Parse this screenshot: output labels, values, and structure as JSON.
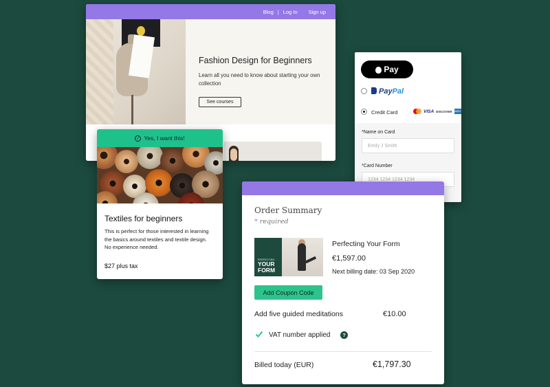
{
  "site": {
    "nav": {
      "blog": "Blog",
      "separator": "|",
      "login": "Log In",
      "signup": "Sign up"
    },
    "hero": {
      "title": "Fashion Design for Beginners",
      "subtitle": "Learn all you need to know about starting your own collection",
      "button": "See courses"
    }
  },
  "textiles": {
    "banner": "Yes, I want this!",
    "title": "Textiles for beginners",
    "description": "This is perfect for those interested in learning the basics around textiles and textile design. No experience needed.",
    "price": "$27 plus tax"
  },
  "payment": {
    "apple_pay": "Pay",
    "paypal_a": "Pay",
    "paypal_b": "Pal",
    "credit_card": "Credit Card",
    "card_logos": {
      "visa": "VISA",
      "discover": "DISCOVER",
      "amex": "AMEX"
    },
    "name_label": "*Name on Card",
    "name_placeholder": "Emily J Smith",
    "number_label": "*Card Number",
    "number_placeholder": "1234 1234 1234 1234",
    "selected": "credit_card"
  },
  "order": {
    "title": "Order Summary",
    "required_star": "*",
    "required": "required",
    "thumb_small": "PERFECTING",
    "thumb_big_1": "YOUR",
    "thumb_big_2": "FORM",
    "product": "Perfecting Your Form",
    "price": "€1,597.00",
    "next_billing": "Next billing date: 03 Sep 2020",
    "coupon_button": "Add Coupon Code",
    "addon": "Add five guided meditations",
    "addon_price": "€10.00",
    "vat": "VAT number applied",
    "help": "?",
    "billed_label": "Billed today (EUR)",
    "billed_total": "€1,797.30"
  },
  "colors": {
    "background": "#1c4a3e",
    "purple": "#9478e6",
    "green": "#2ec38c"
  }
}
